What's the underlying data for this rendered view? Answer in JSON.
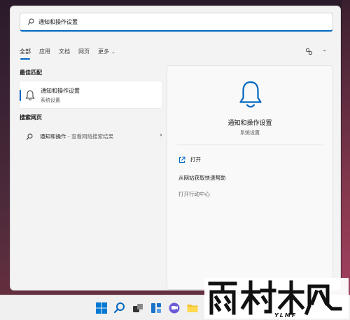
{
  "search": {
    "value": "通知和操作设置"
  },
  "tabs": [
    {
      "label": "全部"
    },
    {
      "label": "应用"
    },
    {
      "label": "文档"
    },
    {
      "label": "网页"
    },
    {
      "label": "更多"
    }
  ],
  "top_actions": {
    "share_icon": "share-icon",
    "more": "···"
  },
  "best_match": {
    "section_title": "最佳匹配",
    "item": {
      "title": "通知和操作设置",
      "subtitle": "系统设置",
      "icon": "bell-icon"
    }
  },
  "web_search": {
    "section_title": "搜索网页",
    "item": {
      "query": "通知和操作",
      "suffix": " - 查看网络搜索结果",
      "icon": "search-icon"
    }
  },
  "detail": {
    "title": "通知和操作设置",
    "subtitle": "系统设置",
    "actions": [
      {
        "label": "打开",
        "icon": "open-external-icon"
      },
      {
        "label": "从网站获取快速帮助"
      },
      {
        "label": "打开行动中心"
      }
    ]
  },
  "taskbar": {
    "icons": [
      "windows-start-icon",
      "search-icon",
      "task-view-icon",
      "widgets-icon",
      "chat-icon",
      "file-explorer-icon"
    ]
  },
  "watermark": {
    "text": "雨林木风",
    "sub": "YLMF"
  },
  "colors": {
    "accent": "#0067c0",
    "panel": "#f3f3f3"
  }
}
